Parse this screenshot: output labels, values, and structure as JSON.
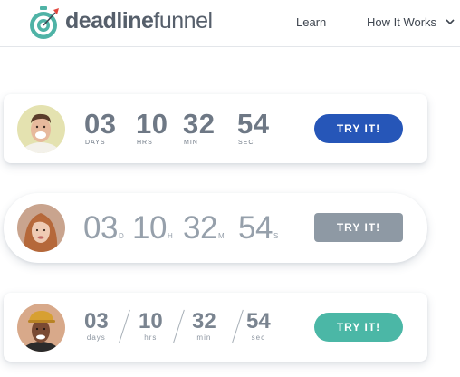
{
  "header": {
    "brand_bold": "deadline",
    "brand_light": "funnel",
    "logo_icon": "stopwatch-target-icon",
    "nav": {
      "learn": "Learn",
      "how_it_works": "How It Works"
    },
    "chevron_icon": "chevron-down-icon"
  },
  "colors": {
    "button_blue": "#2656b8",
    "button_gray": "#8e99a4",
    "button_teal": "#4bb7a6",
    "logo_teal": "#4fb3a6",
    "logo_red": "#e2453c"
  },
  "cards": [
    {
      "timer": [
        {
          "value": "03",
          "unit": "DAYS"
        },
        {
          "value": "10",
          "unit": "HRS"
        },
        {
          "value": "32",
          "unit": "MIN"
        },
        {
          "value": "54",
          "unit": "SEC"
        }
      ],
      "button": "TRY IT!"
    },
    {
      "timer": [
        {
          "value": "03",
          "unit": "D"
        },
        {
          "value": "10",
          "unit": "H"
        },
        {
          "value": "32",
          "unit": "M"
        },
        {
          "value": "54",
          "unit": "S"
        }
      ],
      "button": "TRY IT!"
    },
    {
      "timer": [
        {
          "value": "03",
          "unit": "days"
        },
        {
          "value": "10",
          "unit": "hrs"
        },
        {
          "value": "32",
          "unit": "min"
        },
        {
          "value": "54",
          "unit": "sec"
        }
      ],
      "button": "TRY IT!"
    }
  ]
}
